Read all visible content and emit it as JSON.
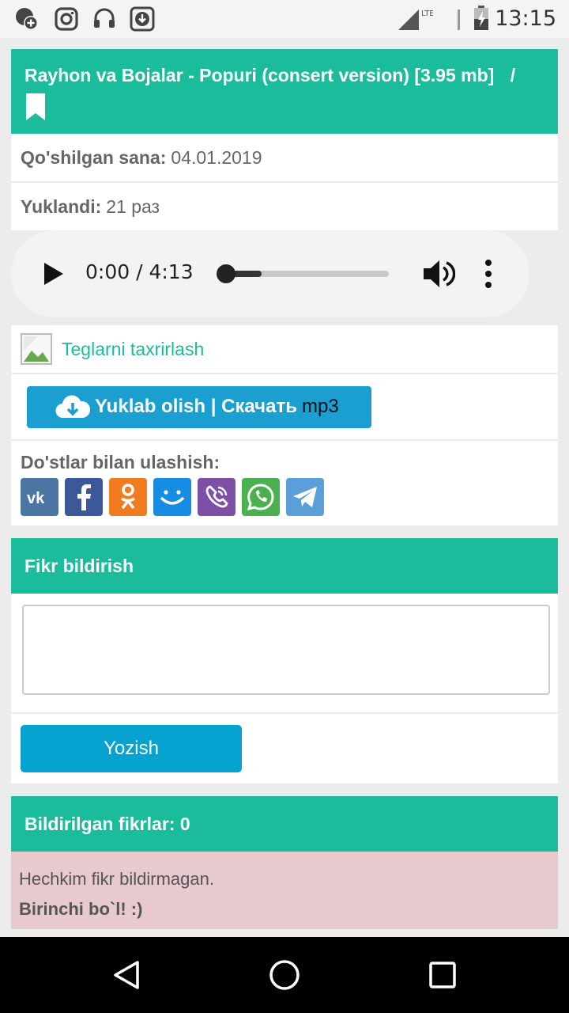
{
  "status_bar": {
    "time": "13:15",
    "network": "LTE",
    "left_icons": [
      "chat-add-icon",
      "instagram-icon",
      "headset-icon",
      "download-icon"
    ]
  },
  "song": {
    "title": "Rayhon va Bojalar - Popuri (consert version) [3.95 mb]",
    "separator": "/",
    "date_label": "Qo'shilgan sana:",
    "date_value": "04.01.2019",
    "downloads_label": "Yuklandi:",
    "downloads_value": "21 раз"
  },
  "player": {
    "time": "0:00 / 4:13",
    "progress": 0.22
  },
  "tags": {
    "link_label": "Teglarni taxrirlash"
  },
  "download": {
    "label": "Yuklab olish | Скачать",
    "format": "mp3"
  },
  "share": {
    "title": "Do'stlar bilan ulashish:",
    "icons": [
      {
        "name": "vk-icon",
        "color": "#4c75a3",
        "glyph": "vk"
      },
      {
        "name": "facebook-icon",
        "color": "#3b5998",
        "glyph": "f"
      },
      {
        "name": "odnoklassniki-icon",
        "color": "#f07c1f",
        "glyph": "ok"
      },
      {
        "name": "mailru-icon",
        "color": "#168de2",
        "glyph": "mm"
      },
      {
        "name": "viber-icon",
        "color": "#7d4fa6",
        "glyph": "vb"
      },
      {
        "name": "whatsapp-icon",
        "color": "#4caf50",
        "glyph": "wa"
      },
      {
        "name": "telegram-icon",
        "color": "#5b9fd8",
        "glyph": "tg"
      }
    ]
  },
  "comment": {
    "section_title": "Fikr bildirish",
    "submit_label": "Yozish"
  },
  "comments_list": {
    "title": "Bildirilgan fikrlar: 0",
    "empty_line1": "Hechkim fikr bildirmagan.",
    "empty_line2": "Birinchi bo`l! :)"
  },
  "colors": {
    "accent": "#1abc9c",
    "button_blue": "#1a9fd0",
    "empty_bg": "#e7c9ce"
  }
}
